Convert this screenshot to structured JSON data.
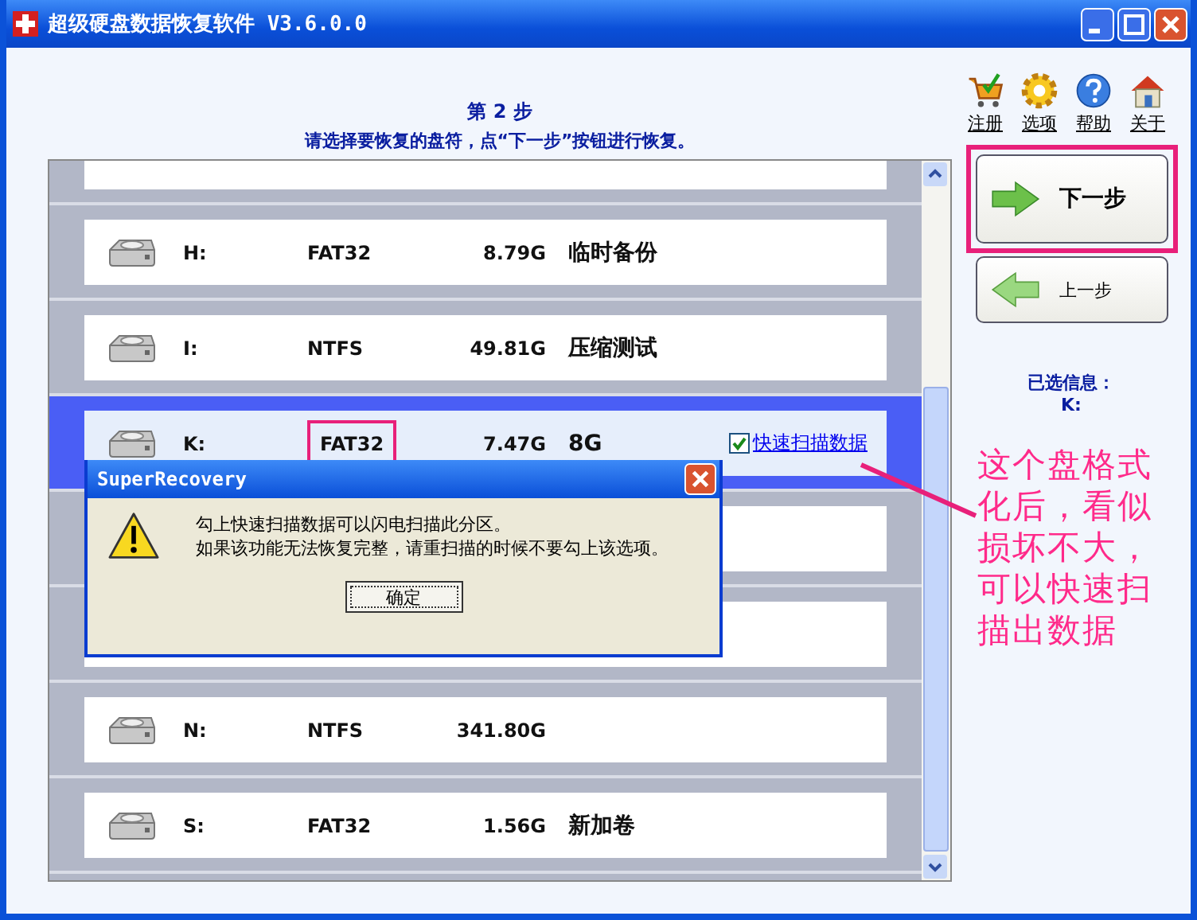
{
  "window": {
    "title": "超级硬盘数据恢复软件 V3.6.0.0"
  },
  "toolbar": [
    {
      "label": "注册",
      "kind": "cart"
    },
    {
      "label": "选项",
      "kind": "gear"
    },
    {
      "label": "帮助",
      "kind": "help"
    },
    {
      "label": "关于",
      "kind": "home"
    }
  ],
  "step": {
    "title": "第 2 步",
    "instruction": "请选择要恢复的盘符，点“下一步”按钮进行恢复。"
  },
  "drives": [
    {
      "kind": "clipped",
      "selected": false
    },
    {
      "kind": "drive",
      "letter": "H:",
      "filesystem": "FAT32",
      "size": "8.79G",
      "label": "临时备份",
      "selected": false,
      "annotated": false
    },
    {
      "kind": "drive",
      "letter": "I:",
      "filesystem": "NTFS",
      "size": "49.81G",
      "label": "压缩测试",
      "selected": false,
      "annotated": false
    },
    {
      "kind": "drive",
      "letter": "K:",
      "filesystem": "FAT32",
      "size": "7.47G",
      "label": "8G",
      "selected": true,
      "annotated": true,
      "quick_scan": {
        "label": "快速扫描数据",
        "checked": true
      }
    },
    {
      "kind": "covered",
      "selected": false
    },
    {
      "kind": "covered",
      "selected": false
    },
    {
      "kind": "drive",
      "letter": "N:",
      "filesystem": "NTFS",
      "size": "341.80G",
      "selected": false,
      "annotated": false
    },
    {
      "kind": "drive",
      "letter": "S:",
      "filesystem": "FAT32",
      "size": "1.56G",
      "label": "新加卷",
      "selected": false,
      "annotated": false
    }
  ],
  "next_button": {
    "label": "下一步",
    "annotated": true
  },
  "prev_button": {
    "label": "上一步"
  },
  "selected_info": {
    "label": "已选信息：",
    "value": "K:"
  },
  "annotation": "这个盘格式化后，看似损坏不大，可以快速扫描出数据",
  "dialog": {
    "title": "SuperRecovery",
    "message_lines": [
      "勾上快速扫描数据可以闪电扫描此分区。",
      "如果该功能无法恢复完整，请重扫描的时候不要勾上该选项。"
    ],
    "ok_button": "确定"
  }
}
